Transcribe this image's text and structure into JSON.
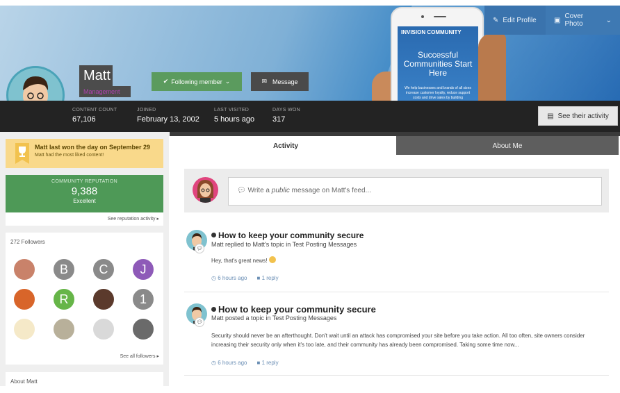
{
  "cover": {
    "edit_profile": "Edit Profile",
    "cover_photo": "Cover Photo",
    "ad_brand": "INVISION COMMUNITY",
    "ad_headline": "Successful Communities Start Here",
    "ad_small": "We help businesses and brands of all sizes increase customer loyalty, reduce support costs and drive sales by building"
  },
  "profile": {
    "name": "Matt",
    "group": "Management",
    "follow_label": "Following member",
    "message_label": "Message"
  },
  "stats": [
    {
      "label": "CONTENT COUNT",
      "value": "67,106"
    },
    {
      "label": "JOINED",
      "value": "February 13, 2002"
    },
    {
      "label": "LAST VISITED",
      "value": "5 hours ago"
    },
    {
      "label": "DAYS WON",
      "value": "317"
    }
  ],
  "see_activity": "See their activity",
  "won": {
    "title": "Matt last won the day on September 29",
    "sub": "Matt had the most liked content!"
  },
  "reputation": {
    "label": "COMMUNITY REPUTATION",
    "value": "9,388",
    "level": "Excellent",
    "link": "See reputation activity"
  },
  "followers": {
    "heading": "272 Followers",
    "see_all": "See all followers",
    "letters": [
      "B",
      "C",
      "J",
      "R",
      "1"
    ]
  },
  "about_heading": "About Matt",
  "tabs": {
    "activity": "Activity",
    "about": "About Me"
  },
  "composer": {
    "pre": "Write a ",
    "em": "public",
    "post": " message on Matt's feed..."
  },
  "feed": [
    {
      "title": "How to keep your community secure",
      "sub": "Matt replied to Matt's topic in Test Posting Messages",
      "body": "Hey, that's great news!",
      "time": "6 hours ago",
      "replies": "1 reply"
    },
    {
      "title": "How to keep your community secure",
      "sub": "Matt posted a topic in Test Posting Messages",
      "body": "Security should never be an afterthought. Don't wait until an attack has compromised your site before you take action. All too often, site owners consider increasing their security only when it's too late, and their community has already been compromised. Taking some time now...",
      "time": "6 hours ago",
      "replies": "1 reply"
    }
  ],
  "colors": {
    "accent": "#3a73ad",
    "follow": "#5b9b5e",
    "reputation": "#4e9957",
    "won": "#f9d98b",
    "statbar": "#232323"
  }
}
